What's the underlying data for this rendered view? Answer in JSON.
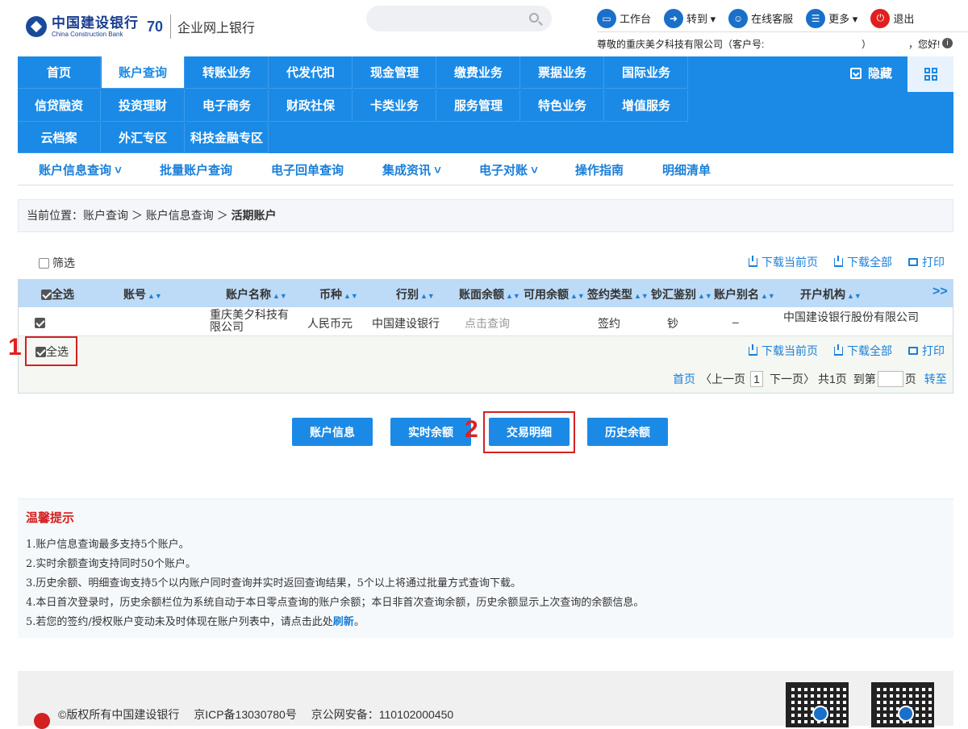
{
  "header": {
    "logo_cn": "中国建设银行",
    "logo_en": "China Construction Bank",
    "anniversary": "70",
    "corp_label": "企业网上银行",
    "search_placeholder": "",
    "toolbar": [
      {
        "label": "工作台",
        "icon": "monitor-icon"
      },
      {
        "label": "转到 ▾",
        "icon": "arrow-right-icon"
      },
      {
        "label": "在线客服",
        "icon": "user-icon"
      },
      {
        "label": "更多 ▾",
        "icon": "menu-icon"
      },
      {
        "label": "退出",
        "icon": "power-icon"
      }
    ],
    "welcome_prefix": "尊敬的重庆美夕科技有限公司（客户号:",
    "welcome_close": "）",
    "welcome_suffix": "，您好!"
  },
  "nav": {
    "row1": [
      "首页",
      "账户查询",
      "转账业务",
      "代发代扣",
      "现金管理",
      "缴费业务",
      "票据业务",
      "国际业务"
    ],
    "row2": [
      "信贷融资",
      "投资理财",
      "电子商务",
      "财政社保",
      "卡类业务",
      "服务管理",
      "特色业务",
      "增值服务"
    ],
    "row3": [
      "云档案",
      "外汇专区",
      "科技金融专区"
    ],
    "hide_label": "隐藏"
  },
  "subnav": [
    "账户信息查询 ˅",
    "批量账户查询",
    "电子回单查询",
    "集成资讯 ˅",
    "电子对账 ˅",
    "操作指南",
    "明细清单"
  ],
  "breadcrumb": {
    "prefix": "当前位置：账户查询 ＞ 账户信息查询 ＞ ",
    "current": "活期账户"
  },
  "filter_label": "筛选",
  "actions": {
    "download_page": "下载当前页",
    "download_all": "下载全部",
    "print": "打印"
  },
  "table": {
    "select_all": "全选",
    "columns": [
      "账号",
      "账户名称",
      "币种",
      "行别",
      "账面余额",
      "可用余额",
      "签约类型",
      "钞汇鉴别",
      "账户别名",
      "开户机构"
    ],
    "more": ">>",
    "rows": [
      {
        "account_no": "",
        "name_line1": "重庆美夕科技有",
        "name_line2": "限公司",
        "currency": "人民币元",
        "bank": "中国建设银行",
        "book_balance": "点击查询",
        "available": "",
        "sign_type": "签约",
        "cash_type": "钞",
        "alias": "–",
        "branch": "中国建设银行股份有限公司"
      }
    ]
  },
  "footer_select_all": "全选",
  "pager": {
    "first": "首页",
    "prev": "〈上一页",
    "current": "1",
    "next": "下一页〉",
    "total": "共1页",
    "goto": "到第",
    "page_unit": "页",
    "go": "转至"
  },
  "buttons": {
    "account_info": "账户信息",
    "realtime_balance": "实时余额",
    "transaction_detail": "交易明细",
    "history_balance": "历史余额"
  },
  "annotations": {
    "mark1": "1",
    "mark2": "2"
  },
  "tips": {
    "title": "温馨提示",
    "items": [
      "1.账户信息查询最多支持5个账户。",
      "2.实时余额查询支持同时50个账户。",
      "3.历史余额、明细查询支持5个以内账户同时查询并实时返回查询结果，5个以上将通过批量方式查询下载。",
      "4.本日首次登录时，历史余额栏位为系统自动于本日零点查询的账户余额；本日非首次查询余额，历史余额显示上次查询的余额信息。"
    ],
    "last_prefix": "5.若您的签约/授权账户变动未及时体现在账户列表中，请点击此处",
    "last_link": "刷新",
    "last_suffix": "。"
  },
  "footer": {
    "copyright": "©版权所有中国建设银行",
    "icp": "京ICP备13030780号",
    "police": "京公网安备：110102000450"
  },
  "colors": {
    "primary": "#1a8ae6",
    "header_row": "#bddaf6",
    "alert_red": "#d32020"
  }
}
